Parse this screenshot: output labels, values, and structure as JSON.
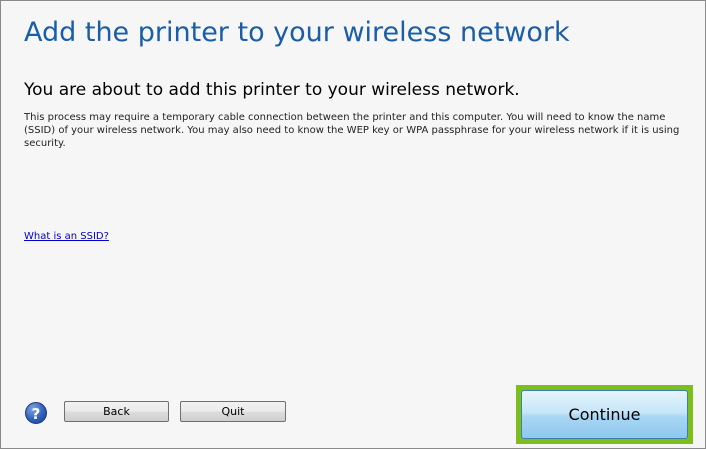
{
  "dialog": {
    "title": "Add the printer to your wireless network",
    "subtitle": "You are about to add this printer to your wireless network.",
    "description": "This process may require a temporary cable connection between the printer and this computer. You will need to know the name (SSID) of your wireless network. You may also need to know the WEP key or WPA passphrase for your wireless network if it is using security.",
    "ssid_link": "What is an SSID?",
    "title_color": "#1a5ea8",
    "highlight_color": "#7cbf1d"
  },
  "footer": {
    "help_icon": "help-question-icon",
    "help_glyph": "?",
    "back_label": "Back",
    "quit_label": "Quit",
    "continue_label": "Continue"
  }
}
